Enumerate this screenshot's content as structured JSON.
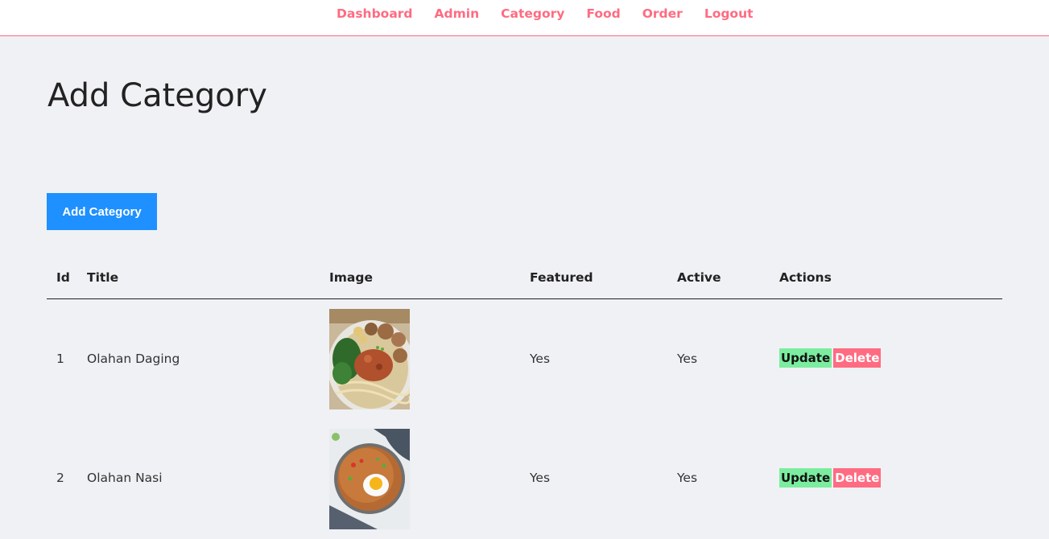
{
  "nav": {
    "items": [
      "Dashboard",
      "Admin",
      "Category",
      "Food",
      "Order",
      "Logout"
    ]
  },
  "page": {
    "title": "Add Category",
    "add_button": "Add Category"
  },
  "table": {
    "headers": {
      "id": "Id",
      "title": "Title",
      "image": "Image",
      "featured": "Featured",
      "active": "Active",
      "actions": "Actions"
    },
    "rows": [
      {
        "id": "1",
        "title": "Olahan Daging",
        "image_alt": "noodle bowl with meatballs and greens",
        "featured": "Yes",
        "active": "Yes",
        "update": "Update",
        "delete": "Delete"
      },
      {
        "id": "2",
        "title": "Olahan Nasi",
        "image_alt": "fried rice bowl with fried egg",
        "featured": "Yes",
        "active": "Yes",
        "update": "Update",
        "delete": "Delete"
      }
    ]
  },
  "colors": {
    "accent_pink": "#ff6b81",
    "primary_blue": "#1e90ff",
    "update_green": "#7bed9f",
    "page_bg": "#f0f1f5"
  }
}
